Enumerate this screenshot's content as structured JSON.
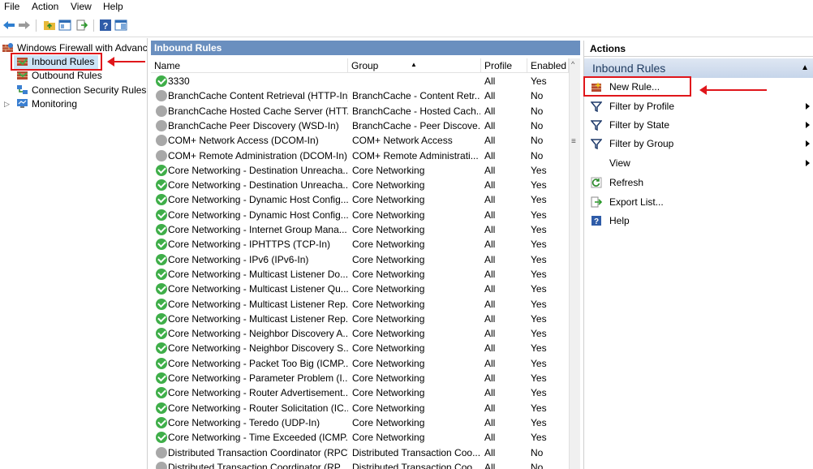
{
  "menu": [
    "File",
    "Action",
    "View",
    "Help"
  ],
  "tree": {
    "root": "Windows Firewall with Advance",
    "items": [
      "Inbound Rules",
      "Outbound Rules",
      "Connection Security Rules",
      "Monitoring"
    ]
  },
  "center": {
    "title": "Inbound Rules",
    "columns": [
      "Name",
      "Group",
      "Profile",
      "Enabled"
    ],
    "rows": [
      {
        "name": "3330",
        "group": "",
        "profile": "All",
        "enabled": "Yes",
        "on": true
      },
      {
        "name": "BranchCache Content Retrieval (HTTP-In)",
        "group": "BranchCache - Content Retr...",
        "profile": "All",
        "enabled": "No",
        "on": false
      },
      {
        "name": "BranchCache Hosted Cache Server (HTT...",
        "group": "BranchCache - Hosted Cach...",
        "profile": "All",
        "enabled": "No",
        "on": false
      },
      {
        "name": "BranchCache Peer Discovery (WSD-In)",
        "group": "BranchCache - Peer Discove...",
        "profile": "All",
        "enabled": "No",
        "on": false
      },
      {
        "name": "COM+ Network Access (DCOM-In)",
        "group": "COM+ Network Access",
        "profile": "All",
        "enabled": "No",
        "on": false
      },
      {
        "name": "COM+ Remote Administration (DCOM-In)",
        "group": "COM+ Remote Administrati...",
        "profile": "All",
        "enabled": "No",
        "on": false
      },
      {
        "name": "Core Networking - Destination Unreacha...",
        "group": "Core Networking",
        "profile": "All",
        "enabled": "Yes",
        "on": true
      },
      {
        "name": "Core Networking - Destination Unreacha...",
        "group": "Core Networking",
        "profile": "All",
        "enabled": "Yes",
        "on": true
      },
      {
        "name": "Core Networking - Dynamic Host Config...",
        "group": "Core Networking",
        "profile": "All",
        "enabled": "Yes",
        "on": true
      },
      {
        "name": "Core Networking - Dynamic Host Config...",
        "group": "Core Networking",
        "profile": "All",
        "enabled": "Yes",
        "on": true
      },
      {
        "name": "Core Networking - Internet Group Mana...",
        "group": "Core Networking",
        "profile": "All",
        "enabled": "Yes",
        "on": true
      },
      {
        "name": "Core Networking - IPHTTPS (TCP-In)",
        "group": "Core Networking",
        "profile": "All",
        "enabled": "Yes",
        "on": true
      },
      {
        "name": "Core Networking - IPv6 (IPv6-In)",
        "group": "Core Networking",
        "profile": "All",
        "enabled": "Yes",
        "on": true
      },
      {
        "name": "Core Networking - Multicast Listener Do...",
        "group": "Core Networking",
        "profile": "All",
        "enabled": "Yes",
        "on": true
      },
      {
        "name": "Core Networking - Multicast Listener Qu...",
        "group": "Core Networking",
        "profile": "All",
        "enabled": "Yes",
        "on": true
      },
      {
        "name": "Core Networking - Multicast Listener Rep...",
        "group": "Core Networking",
        "profile": "All",
        "enabled": "Yes",
        "on": true
      },
      {
        "name": "Core Networking - Multicast Listener Rep...",
        "group": "Core Networking",
        "profile": "All",
        "enabled": "Yes",
        "on": true
      },
      {
        "name": "Core Networking - Neighbor Discovery A...",
        "group": "Core Networking",
        "profile": "All",
        "enabled": "Yes",
        "on": true
      },
      {
        "name": "Core Networking - Neighbor Discovery S...",
        "group": "Core Networking",
        "profile": "All",
        "enabled": "Yes",
        "on": true
      },
      {
        "name": "Core Networking - Packet Too Big (ICMP...",
        "group": "Core Networking",
        "profile": "All",
        "enabled": "Yes",
        "on": true
      },
      {
        "name": "Core Networking - Parameter Problem (I...",
        "group": "Core Networking",
        "profile": "All",
        "enabled": "Yes",
        "on": true
      },
      {
        "name": "Core Networking - Router Advertisement...",
        "group": "Core Networking",
        "profile": "All",
        "enabled": "Yes",
        "on": true
      },
      {
        "name": "Core Networking - Router Solicitation (IC...",
        "group": "Core Networking",
        "profile": "All",
        "enabled": "Yes",
        "on": true
      },
      {
        "name": "Core Networking - Teredo (UDP-In)",
        "group": "Core Networking",
        "profile": "All",
        "enabled": "Yes",
        "on": true
      },
      {
        "name": "Core Networking - Time Exceeded (ICMP...",
        "group": "Core Networking",
        "profile": "All",
        "enabled": "Yes",
        "on": true
      },
      {
        "name": "Distributed Transaction Coordinator (RPC)",
        "group": "Distributed Transaction Coo...",
        "profile": "All",
        "enabled": "No",
        "on": false
      },
      {
        "name": "Distributed Transaction Coordinator (RP...",
        "group": "Distributed Transaction Coo...",
        "profile": "All",
        "enabled": "No",
        "on": false
      }
    ]
  },
  "actions": {
    "title": "Actions",
    "section": "Inbound Rules",
    "items": [
      {
        "label": "New Rule...",
        "icon": "new-rule-icon",
        "submenu": false
      },
      {
        "label": "Filter by Profile",
        "icon": "filter-icon",
        "submenu": true
      },
      {
        "label": "Filter by State",
        "icon": "filter-icon",
        "submenu": true
      },
      {
        "label": "Filter by Group",
        "icon": "filter-icon",
        "submenu": true
      },
      {
        "label": "View",
        "icon": "",
        "submenu": true
      },
      {
        "label": "Refresh",
        "icon": "refresh-icon",
        "submenu": false
      },
      {
        "label": "Export List...",
        "icon": "export-icon",
        "submenu": false
      },
      {
        "label": "Help",
        "icon": "help-icon",
        "submenu": false
      }
    ]
  }
}
